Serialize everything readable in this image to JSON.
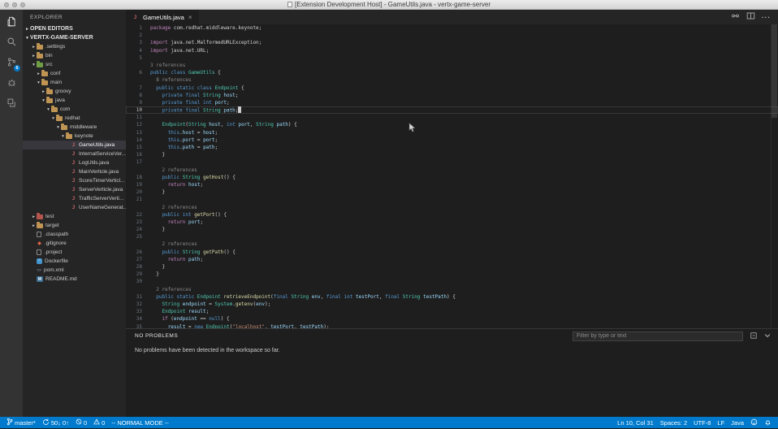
{
  "window": {
    "title": "[Extension Development Host] - GameUtils.java - vertx-game-server"
  },
  "colors": {
    "accent": "#007acc",
    "badge": "#007acc",
    "selection": "#37373d"
  },
  "activity_bar": {
    "items": [
      {
        "name": "explorer",
        "active": true
      },
      {
        "name": "search",
        "active": false
      },
      {
        "name": "source-control",
        "active": false,
        "badge": "6"
      },
      {
        "name": "debug",
        "active": false
      },
      {
        "name": "extensions",
        "active": false
      }
    ]
  },
  "sidebar": {
    "title": "EXPLORER",
    "open_editors_label": "OPEN EDITORS",
    "root_label": "VERTX-GAME-SERVER",
    "tree": [
      {
        "label": ".settings",
        "indent": 1,
        "arrow": "collapsed",
        "icon": "folder"
      },
      {
        "label": "bin",
        "indent": 1,
        "arrow": "collapsed",
        "icon": "folder"
      },
      {
        "label": "src",
        "indent": 1,
        "arrow": "expanded",
        "icon": "folder-green"
      },
      {
        "label": "conf",
        "indent": 2,
        "arrow": "collapsed",
        "icon": "folder"
      },
      {
        "label": "main",
        "indent": 2,
        "arrow": "expanded",
        "icon": "folder"
      },
      {
        "label": "groovy",
        "indent": 3,
        "arrow": "collapsed",
        "icon": "folder"
      },
      {
        "label": "java",
        "indent": 3,
        "arrow": "expanded",
        "icon": "folder"
      },
      {
        "label": "com",
        "indent": 4,
        "arrow": "expanded",
        "icon": "folder"
      },
      {
        "label": "redhat",
        "indent": 5,
        "arrow": "expanded",
        "icon": "folder"
      },
      {
        "label": "middleware",
        "indent": 6,
        "arrow": "expanded",
        "icon": "folder"
      },
      {
        "label": "keynote",
        "indent": 7,
        "arrow": "expanded",
        "icon": "folder"
      },
      {
        "label": "GameUtils.java",
        "indent": 8,
        "arrow": "none",
        "icon": "java",
        "selected": true
      },
      {
        "label": "InternalServiceVer...",
        "indent": 8,
        "arrow": "none",
        "icon": "java"
      },
      {
        "label": "LogUtils.java",
        "indent": 8,
        "arrow": "none",
        "icon": "java"
      },
      {
        "label": "MainVerticle.java",
        "indent": 8,
        "arrow": "none",
        "icon": "java"
      },
      {
        "label": "ScoreTimerVerticl...",
        "indent": 8,
        "arrow": "none",
        "icon": "java"
      },
      {
        "label": "ServerVerticle.java",
        "indent": 8,
        "arrow": "none",
        "icon": "java"
      },
      {
        "label": "TrafficServerVerti...",
        "indent": 8,
        "arrow": "none",
        "icon": "java"
      },
      {
        "label": "UserNameGenerat...",
        "indent": 8,
        "arrow": "none",
        "icon": "java"
      },
      {
        "label": "test",
        "indent": 1,
        "arrow": "collapsed",
        "icon": "folder-red"
      },
      {
        "label": "target",
        "indent": 1,
        "arrow": "collapsed",
        "icon": "folder"
      },
      {
        "label": ".classpath",
        "indent": 1,
        "arrow": "none",
        "icon": "file"
      },
      {
        "label": ".gitignore",
        "indent": 1,
        "arrow": "none",
        "icon": "git"
      },
      {
        "label": ".project",
        "indent": 1,
        "arrow": "none",
        "icon": "file"
      },
      {
        "label": "Dockerfile",
        "indent": 1,
        "arrow": "none",
        "icon": "docker"
      },
      {
        "label": "pom.xml",
        "indent": 1,
        "arrow": "none",
        "icon": "xml"
      },
      {
        "label": "README.md",
        "indent": 1,
        "arrow": "none",
        "icon": "md"
      }
    ]
  },
  "editor": {
    "tab": {
      "label": "GameUtils.java",
      "close_glyph": "×"
    },
    "actions": [
      {
        "name": "open-changes"
      },
      {
        "name": "split-editor"
      },
      {
        "name": "more-actions"
      }
    ],
    "lines": [
      {
        "n": 1,
        "parts": [
          [
            "k1",
            "package"
          ],
          [
            "p",
            " com.redhat.middleware.keynote;"
          ]
        ]
      },
      {
        "n": 2,
        "parts": []
      },
      {
        "n": 3,
        "parts": [
          [
            "k1",
            "import"
          ],
          [
            "p",
            " java.net.MalformedURLException;"
          ]
        ]
      },
      {
        "n": 4,
        "parts": [
          [
            "k1",
            "import"
          ],
          [
            "p",
            " java.net.URL;"
          ]
        ]
      },
      {
        "n": 5,
        "parts": []
      },
      {
        "lens": "3 references"
      },
      {
        "n": 6,
        "parts": [
          [
            "k2",
            "public class "
          ],
          [
            "ty",
            "GameUtils"
          ],
          [
            "p",
            " {"
          ]
        ]
      },
      {
        "lens": "  8 references"
      },
      {
        "n": 7,
        "parts": [
          [
            "k2",
            "  public static class "
          ],
          [
            "ty",
            "Endpoint"
          ],
          [
            "p",
            " {"
          ]
        ]
      },
      {
        "n": 8,
        "parts": [
          [
            "k2",
            "    private final "
          ],
          [
            "ty",
            "String"
          ],
          [
            "p",
            " "
          ],
          [
            "v",
            "host"
          ],
          [
            "p",
            ";"
          ]
        ]
      },
      {
        "n": 9,
        "parts": [
          [
            "k2",
            "    private final int "
          ],
          [
            "v",
            "port"
          ],
          [
            "p",
            ";"
          ]
        ]
      },
      {
        "n": 10,
        "current": true,
        "cursor": true,
        "parts": [
          [
            "k2",
            "    private final "
          ],
          [
            "ty",
            "String"
          ],
          [
            "p",
            " "
          ],
          [
            "v",
            "path"
          ],
          [
            "p",
            ";"
          ]
        ]
      },
      {
        "n": 11,
        "parts": []
      },
      {
        "n": 12,
        "parts": [
          [
            "p",
            "    "
          ],
          [
            "ty",
            "Endpoint"
          ],
          [
            "p",
            "("
          ],
          [
            "ty",
            "String"
          ],
          [
            "p",
            " "
          ],
          [
            "v",
            "host"
          ],
          [
            "p",
            ", "
          ],
          [
            "k2",
            "int"
          ],
          [
            "p",
            " "
          ],
          [
            "v",
            "port"
          ],
          [
            "p",
            ", "
          ],
          [
            "ty",
            "String"
          ],
          [
            "p",
            " "
          ],
          [
            "v",
            "path"
          ],
          [
            "p",
            ") {"
          ]
        ]
      },
      {
        "n": 13,
        "parts": [
          [
            "p",
            "      "
          ],
          [
            "k2",
            "this"
          ],
          [
            "p",
            "."
          ],
          [
            "v",
            "host"
          ],
          [
            "p",
            " = "
          ],
          [
            "v",
            "host"
          ],
          [
            "p",
            ";"
          ]
        ]
      },
      {
        "n": 14,
        "parts": [
          [
            "p",
            "      "
          ],
          [
            "k2",
            "this"
          ],
          [
            "p",
            "."
          ],
          [
            "v",
            "port"
          ],
          [
            "p",
            " = "
          ],
          [
            "v",
            "port"
          ],
          [
            "p",
            ";"
          ]
        ]
      },
      {
        "n": 15,
        "parts": [
          [
            "p",
            "      "
          ],
          [
            "k2",
            "this"
          ],
          [
            "p",
            "."
          ],
          [
            "v",
            "path"
          ],
          [
            "p",
            " = "
          ],
          [
            "v",
            "path"
          ],
          [
            "p",
            ";"
          ]
        ]
      },
      {
        "n": 16,
        "parts": [
          [
            "p",
            "    }"
          ]
        ]
      },
      {
        "n": 17,
        "parts": []
      },
      {
        "lens": "    2 references"
      },
      {
        "n": 18,
        "parts": [
          [
            "k2",
            "    public "
          ],
          [
            "ty",
            "String"
          ],
          [
            "p",
            " "
          ],
          [
            "fn",
            "getHost"
          ],
          [
            "p",
            "() {"
          ]
        ]
      },
      {
        "n": 19,
        "parts": [
          [
            "p",
            "      "
          ],
          [
            "k1",
            "return"
          ],
          [
            "p",
            " "
          ],
          [
            "v",
            "host"
          ],
          [
            "p",
            ";"
          ]
        ]
      },
      {
        "n": 20,
        "parts": [
          [
            "p",
            "    }"
          ]
        ]
      },
      {
        "n": 21,
        "parts": []
      },
      {
        "lens": "    2 references"
      },
      {
        "n": 22,
        "parts": [
          [
            "k2",
            "    public int "
          ],
          [
            "fn",
            "getPort"
          ],
          [
            "p",
            "() {"
          ]
        ]
      },
      {
        "n": 23,
        "parts": [
          [
            "p",
            "      "
          ],
          [
            "k1",
            "return"
          ],
          [
            "p",
            " "
          ],
          [
            "v",
            "port"
          ],
          [
            "p",
            ";"
          ]
        ]
      },
      {
        "n": 24,
        "parts": [
          [
            "p",
            "    }"
          ]
        ]
      },
      {
        "n": 25,
        "parts": []
      },
      {
        "lens": "    2 references"
      },
      {
        "n": 26,
        "parts": [
          [
            "k2",
            "    public "
          ],
          [
            "ty",
            "String"
          ],
          [
            "p",
            " "
          ],
          [
            "fn",
            "getPath"
          ],
          [
            "p",
            "() {"
          ]
        ]
      },
      {
        "n": 27,
        "parts": [
          [
            "p",
            "      "
          ],
          [
            "k1",
            "return"
          ],
          [
            "p",
            " "
          ],
          [
            "v",
            "path"
          ],
          [
            "p",
            ";"
          ]
        ]
      },
      {
        "n": 28,
        "parts": [
          [
            "p",
            "    }"
          ]
        ]
      },
      {
        "n": 29,
        "parts": [
          [
            "p",
            "  }"
          ]
        ]
      },
      {
        "n": 30,
        "parts": []
      },
      {
        "lens": "  2 references"
      },
      {
        "n": 31,
        "parts": [
          [
            "k2",
            "  public static "
          ],
          [
            "ty",
            "Endpoint"
          ],
          [
            "p",
            " "
          ],
          [
            "fn",
            "retrieveEndpoint"
          ],
          [
            "p",
            "("
          ],
          [
            "k2",
            "final "
          ],
          [
            "ty",
            "String"
          ],
          [
            "p",
            " "
          ],
          [
            "v",
            "env"
          ],
          [
            "p",
            ", "
          ],
          [
            "k2",
            "final int"
          ],
          [
            "p",
            " "
          ],
          [
            "v",
            "testPort"
          ],
          [
            "p",
            ", "
          ],
          [
            "k2",
            "final "
          ],
          [
            "ty",
            "String"
          ],
          [
            "p",
            " "
          ],
          [
            "v",
            "testPath"
          ],
          [
            "p",
            ") {"
          ]
        ]
      },
      {
        "n": 32,
        "parts": [
          [
            "p",
            "    "
          ],
          [
            "ty",
            "String"
          ],
          [
            "p",
            " "
          ],
          [
            "v",
            "endpoint"
          ],
          [
            "p",
            " = "
          ],
          [
            "ty",
            "System"
          ],
          [
            "p",
            "."
          ],
          [
            "fn",
            "getenv"
          ],
          [
            "p",
            "("
          ],
          [
            "v",
            "env"
          ],
          [
            "p",
            ");"
          ]
        ]
      },
      {
        "n": 33,
        "parts": [
          [
            "p",
            "    "
          ],
          [
            "ty",
            "Endpoint"
          ],
          [
            "p",
            " "
          ],
          [
            "v",
            "result"
          ],
          [
            "p",
            ";"
          ]
        ]
      },
      {
        "n": 34,
        "parts": [
          [
            "p",
            "    "
          ],
          [
            "k1",
            "if"
          ],
          [
            "p",
            " ("
          ],
          [
            "v",
            "endpoint"
          ],
          [
            "p",
            " == "
          ],
          [
            "k2",
            "null"
          ],
          [
            "p",
            ") {"
          ]
        ]
      },
      {
        "n": 35,
        "parts": [
          [
            "p",
            "      "
          ],
          [
            "v",
            "result"
          ],
          [
            "p",
            " = "
          ],
          [
            "k2",
            "new"
          ],
          [
            "p",
            " "
          ],
          [
            "ty",
            "Endpoint"
          ],
          [
            "p",
            "("
          ],
          [
            "s",
            "\"localhost\""
          ],
          [
            "p",
            ", "
          ],
          [
            "v",
            "testPort"
          ],
          [
            "p",
            ", "
          ],
          [
            "v",
            "testPath"
          ],
          [
            "p",
            ");"
          ]
        ]
      }
    ]
  },
  "panel": {
    "header": "NO PROBLEMS",
    "filter_placeholder": "Filter by type or text",
    "message": "No problems have been detected in the workspace so far.",
    "actions": [
      {
        "name": "collapse-all"
      },
      {
        "name": "hide-panel-chevron"
      }
    ]
  },
  "status_bar": {
    "left": [
      {
        "name": "git-branch",
        "icon": "branch",
        "label": "master*"
      },
      {
        "name": "sync",
        "icon": "sync",
        "label": "50↓ 0↑"
      },
      {
        "name": "errors",
        "icon": "error",
        "label": "0"
      },
      {
        "name": "warnings",
        "icon": "warning",
        "label": "0"
      },
      {
        "name": "vim-mode",
        "label": "-- NORMAL MODE --"
      }
    ],
    "right": [
      {
        "name": "cursor-position",
        "label": "Ln 10, Col 31"
      },
      {
        "name": "indentation",
        "label": "Spaces: 2"
      },
      {
        "name": "encoding",
        "label": "UTF-8"
      },
      {
        "name": "eol",
        "label": "LF"
      },
      {
        "name": "language-mode",
        "label": "Java"
      },
      {
        "name": "feedback",
        "icon": "smiley"
      },
      {
        "name": "notifications",
        "icon": "bell"
      }
    ]
  }
}
